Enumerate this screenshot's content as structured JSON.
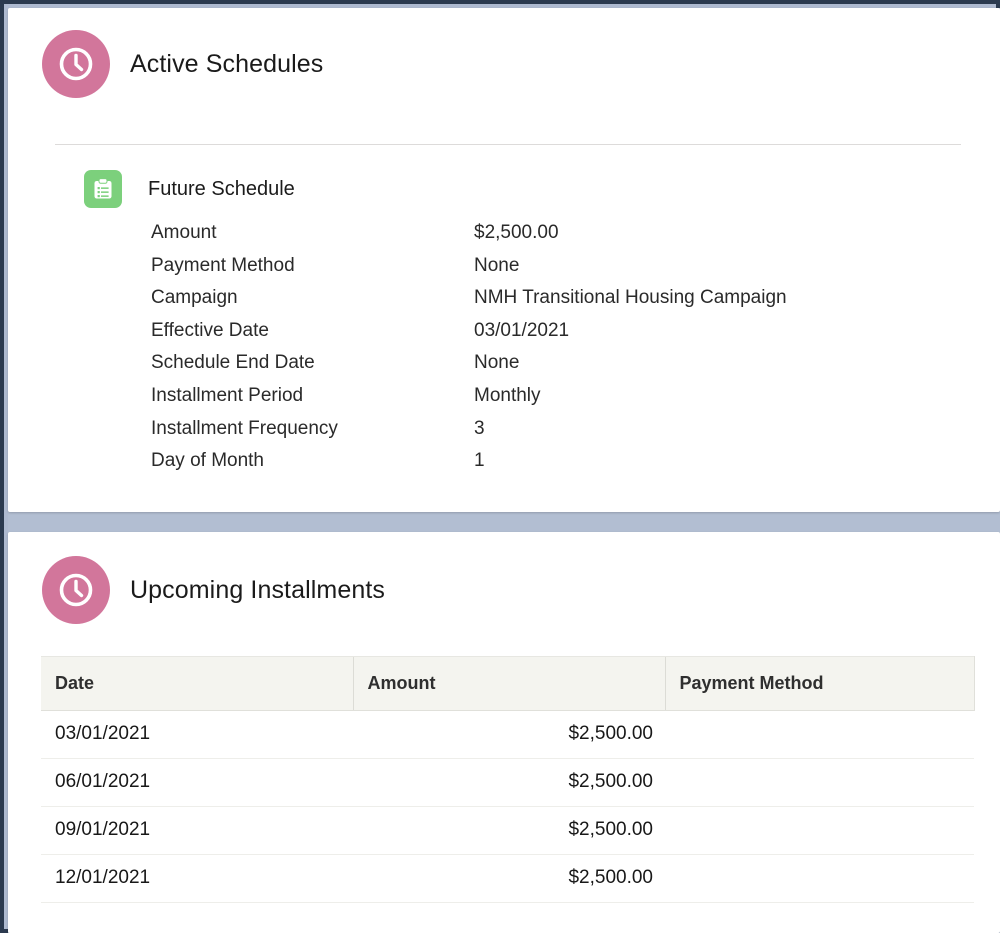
{
  "theme": {
    "accent_pink": "#d2769b",
    "accent_green": "#7cd07c",
    "frame_border": "#2b3a4f",
    "page_background": "#b2bed2",
    "card_background": "#ffffff",
    "table_header_background": "#f4f4ef",
    "text_color": "#1b1b1b"
  },
  "active_schedules": {
    "icon": "clock-icon",
    "title": "Active Schedules",
    "schedule": {
      "icon": "clipboard-list-icon",
      "name": "Future Schedule",
      "fields": [
        {
          "label": "Amount",
          "value": "$2,500.00"
        },
        {
          "label": "Payment Method",
          "value": "None"
        },
        {
          "label": "Campaign",
          "value": "NMH Transitional Housing Campaign"
        },
        {
          "label": "Effective Date",
          "value": "03/01/2021"
        },
        {
          "label": "Schedule End Date",
          "value": "None"
        },
        {
          "label": "Installment Period",
          "value": "Monthly"
        },
        {
          "label": "Installment Frequency",
          "value": "3"
        },
        {
          "label": "Day of Month",
          "value": "1"
        }
      ]
    }
  },
  "upcoming_installments": {
    "icon": "clock-icon",
    "title": "Upcoming Installments",
    "table": {
      "columns": [
        "Date",
        "Amount",
        "Payment Method"
      ],
      "rows": [
        {
          "date": "03/01/2021",
          "amount": "$2,500.00",
          "payment_method": ""
        },
        {
          "date": "06/01/2021",
          "amount": "$2,500.00",
          "payment_method": ""
        },
        {
          "date": "09/01/2021",
          "amount": "$2,500.00",
          "payment_method": ""
        },
        {
          "date": "12/01/2021",
          "amount": "$2,500.00",
          "payment_method": ""
        }
      ]
    }
  }
}
